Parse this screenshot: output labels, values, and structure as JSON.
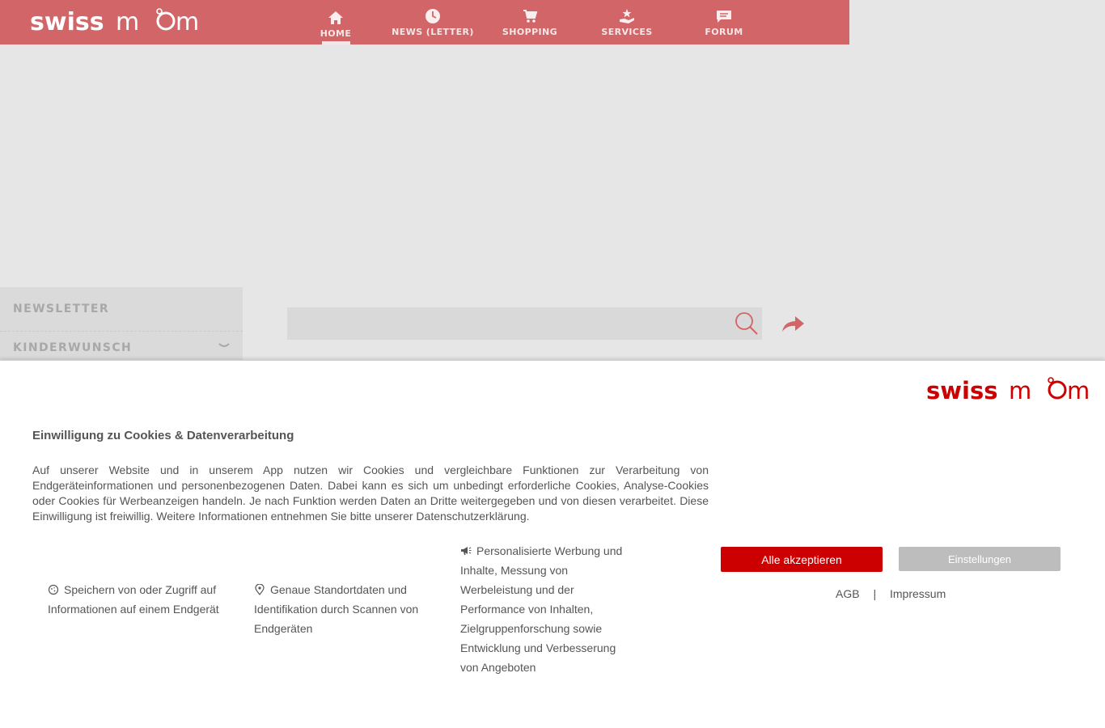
{
  "brand": {
    "logo_text": "swissmom",
    "color": "#d16567"
  },
  "nav": {
    "items": [
      {
        "label": "HOME",
        "icon": "home-icon",
        "active": true
      },
      {
        "label": "NEWS (LETTER)",
        "icon": "clock-icon",
        "active": false
      },
      {
        "label": "SHOPPING",
        "icon": "cart-icon",
        "active": false
      },
      {
        "label": "SERVICES",
        "icon": "star-hand-icon",
        "active": false
      },
      {
        "label": "FORUM",
        "icon": "chat-icon",
        "active": false
      }
    ]
  },
  "sidebar": {
    "items": [
      {
        "label": "NEWSLETTER"
      },
      {
        "label": "KINDERWUNSCH",
        "chevron": "›"
      }
    ]
  },
  "search": {
    "value": "",
    "placeholder": ""
  },
  "cookie": {
    "title": "Einwilligung zu Cookies & Datenverarbeitung",
    "text": "Auf unserer Website und in unserem App nutzen wir Cookies und vergleichbare Funktionen zur Verarbeitung von Endgeräteinformationen und personenbezogenen Daten. Dabei kann es sich um unbedingt erforderliche Cookies, Analyse-Cookies oder Cookies für Werbeanzeigen handeln. Je nach Funktion werden Daten an Dritte weitergegeben und von diesen verarbeitet. Diese Einwilligung ist freiwillig. Weitere Informationen entnehmen Sie bitte unserer Datenschutzerklärung.",
    "purposes": [
      {
        "icon": "cookie-icon",
        "text": "Speichern von oder Zugriff auf Informationen auf einem Endgerät"
      },
      {
        "icon": "location-pin-icon",
        "text": "Genaue Standortdaten und Identifikation durch Scannen von Endgeräten"
      },
      {
        "icon": "megaphone-icon",
        "text": "Personalisierte Werbung und Inhalte, Messung von Werbeleistung und der Performance von Inhalten, Zielgruppenforschung sowie Entwicklung und Verbesserung von Angeboten"
      }
    ],
    "accept_label": "Alle akzeptieren",
    "settings_label": "Einstellungen",
    "accept_color": "#cc0000",
    "links": {
      "agb": "AGB",
      "separator": "|",
      "impressum": "Impressum"
    }
  }
}
